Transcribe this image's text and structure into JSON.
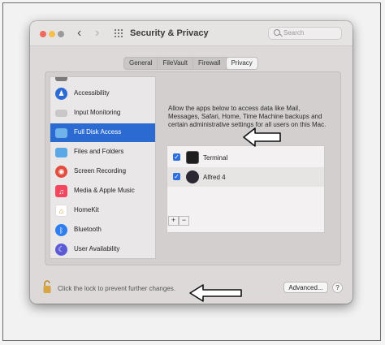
{
  "window": {
    "title": "Security & Privacy",
    "search_placeholder": "Search"
  },
  "tabs": [
    {
      "label": "General",
      "active": false
    },
    {
      "label": "FileVault",
      "active": false
    },
    {
      "label": "Firewall",
      "active": false
    },
    {
      "label": "Privacy",
      "active": true
    }
  ],
  "sidebar": {
    "items": [
      {
        "label": "",
        "icon": "partial-icon",
        "selected": false
      },
      {
        "label": "Accessibility",
        "icon": "accessibility-icon",
        "selected": false
      },
      {
        "label": "Input Monitoring",
        "icon": "keyboard-icon",
        "selected": false
      },
      {
        "label": "Full Disk Access",
        "icon": "folder-icon",
        "selected": true
      },
      {
        "label": "Files and Folders",
        "icon": "folder-icon",
        "selected": false
      },
      {
        "label": "Screen Recording",
        "icon": "record-icon",
        "selected": false
      },
      {
        "label": "Media & Apple Music",
        "icon": "music-icon",
        "selected": false
      },
      {
        "label": "HomeKit",
        "icon": "home-icon",
        "selected": false
      },
      {
        "label": "Bluetooth",
        "icon": "bluetooth-icon",
        "selected": false
      },
      {
        "label": "User Availability",
        "icon": "moon-icon",
        "selected": false
      }
    ]
  },
  "main": {
    "description": "Allow the apps below to access data like Mail, Messages, Safari, Home, Time Machine backups and certain administrative settings for all users on this Mac.",
    "apps": [
      {
        "label": "Terminal",
        "checked": true,
        "icon": "terminal-icon"
      },
      {
        "label": "Alfred 4",
        "checked": true,
        "icon": "alfred-icon"
      }
    ],
    "add_label": "+",
    "remove_label": "−"
  },
  "footer": {
    "lock_text": "Click the lock to prevent further changes.",
    "advanced_label": "Advanced...",
    "help_label": "?"
  },
  "colors": {
    "selection": "#2b6ad1",
    "checkbox": "#2d6ee0"
  }
}
